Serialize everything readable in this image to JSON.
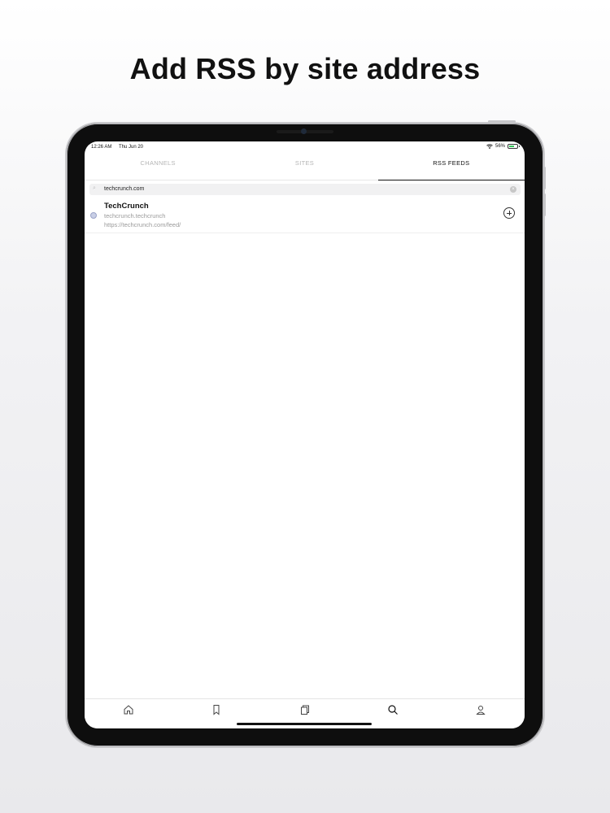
{
  "headline": "Add RSS by site address",
  "status_bar": {
    "time": "12:26 AM",
    "date": "Thu Jun 20",
    "battery": "56%"
  },
  "tabs": [
    {
      "label": "CHANNELS",
      "active": false
    },
    {
      "label": "SITES",
      "active": false
    },
    {
      "label": "RSS FEEDS",
      "active": true
    }
  ],
  "search": {
    "value": "techcrunch.com"
  },
  "results": [
    {
      "title": "TechCrunch",
      "subtitle": "techcrunch.techcrunch",
      "url": "https://techcrunch.com/feed/"
    }
  ],
  "tabbar": {
    "icons": [
      "home-icon",
      "bookmark-icon",
      "copy-icon",
      "search-icon",
      "profile-icon"
    ]
  }
}
